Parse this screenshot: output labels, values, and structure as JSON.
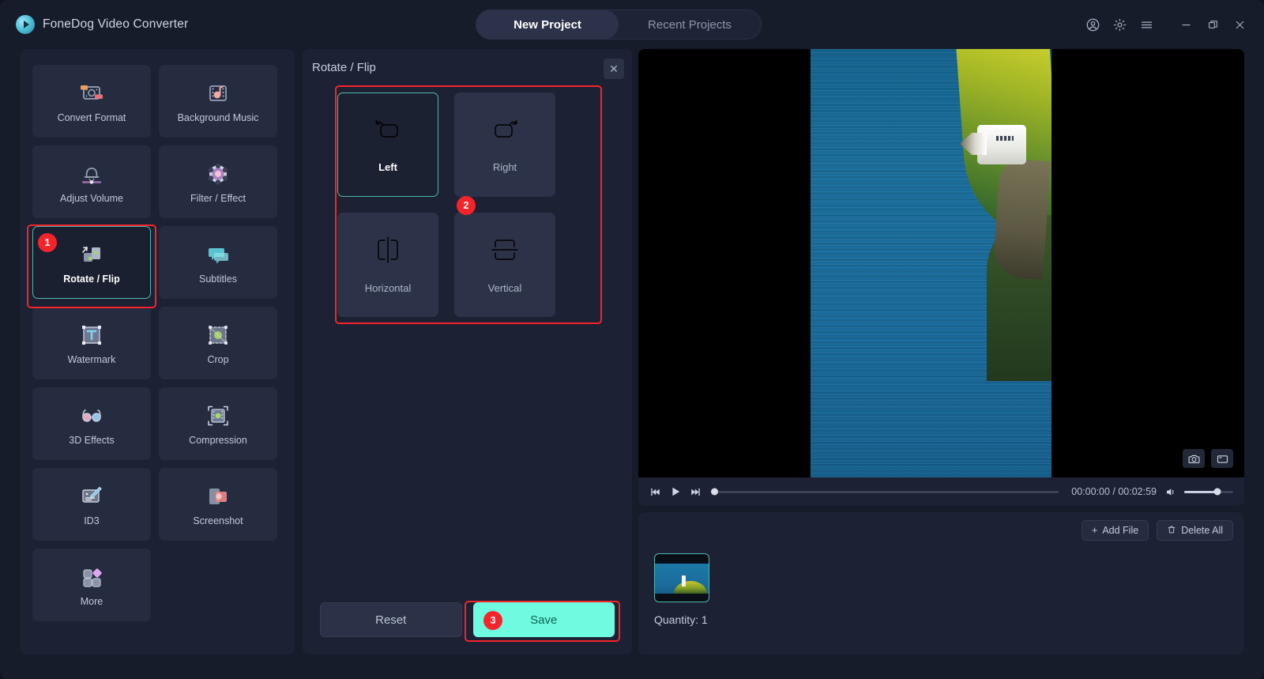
{
  "app": {
    "brand_name": "FoneDog Video Converter",
    "logo_icon": "play-circle-icon",
    "accent_teal": "#4fb8ac",
    "accent_save": "#6ffbe0",
    "annotation_red": "#f5242b",
    "bg_app": "#171c2b",
    "bg_panel": "#1c2133",
    "bg_tile": "#262c40"
  },
  "header": {
    "tabs": [
      {
        "label": "New Project",
        "active": true
      },
      {
        "label": "Recent Projects",
        "active": false
      }
    ],
    "window_icons": [
      {
        "name": "account-icon",
        "glyph": "account"
      },
      {
        "name": "settings-gear-icon",
        "glyph": "gear"
      },
      {
        "name": "hamburger-menu-icon",
        "glyph": "menu"
      },
      {
        "name": "minimize-icon",
        "glyph": "minimize"
      },
      {
        "name": "maximize-icon",
        "glyph": "maximize"
      },
      {
        "name": "close-icon",
        "glyph": "close"
      }
    ]
  },
  "sidebar": {
    "tools": [
      {
        "label": "Convert Format",
        "icon": "convert-format-icon",
        "selected": false
      },
      {
        "label": "Background Music",
        "icon": "background-music-icon",
        "selected": false
      },
      {
        "label": "Adjust Volume",
        "icon": "adjust-volume-icon",
        "selected": false
      },
      {
        "label": "Filter / Effect",
        "icon": "filter-effect-icon",
        "selected": false
      },
      {
        "label": "Rotate / Flip",
        "icon": "rotate-flip-icon",
        "selected": true
      },
      {
        "label": "Subtitles",
        "icon": "subtitles-icon",
        "selected": false
      },
      {
        "label": "Watermark",
        "icon": "watermark-icon",
        "selected": false
      },
      {
        "label": "Crop",
        "icon": "crop-icon",
        "selected": false
      },
      {
        "label": "3D Effects",
        "icon": "3d-effects-icon",
        "selected": false
      },
      {
        "label": "Compression",
        "icon": "compression-icon",
        "selected": false
      },
      {
        "label": "ID3",
        "icon": "id3-icon",
        "selected": false
      },
      {
        "label": "Screenshot",
        "icon": "screenshot-icon",
        "selected": false
      },
      {
        "label": "More",
        "icon": "more-icon",
        "selected": false
      }
    ]
  },
  "panel": {
    "title": "Rotate / Flip",
    "close_label": "✕",
    "options": [
      {
        "label": "Left",
        "icon": "rotate-left-icon",
        "selected": true
      },
      {
        "label": "Right",
        "icon": "rotate-right-icon",
        "selected": false
      },
      {
        "label": "Horizontal",
        "icon": "flip-horizontal-icon",
        "selected": false
      },
      {
        "label": "Vertical",
        "icon": "flip-vertical-icon",
        "selected": false
      }
    ],
    "reset_label": "Reset",
    "save_label": "Save"
  },
  "annotations": {
    "badge_1": "1",
    "badge_2": "2",
    "badge_3": "3"
  },
  "player": {
    "prev_icon": "skip-previous-icon",
    "play_icon": "play-icon",
    "next_icon": "skip-next-icon",
    "current_time": "00:00:00",
    "total_time": "00:02:59",
    "timecode": "00:00:00 / 00:02:59",
    "volume_icon": "volume-icon",
    "volume_percent": 68,
    "seek_percent": 0,
    "snapshot_icon": "camera-icon",
    "fullscreen_icon": "fullscreen-icon"
  },
  "filelist": {
    "add_file_label": "Add File",
    "add_file_icon": "plus-icon",
    "delete_all_label": "Delete All",
    "delete_all_icon": "trash-icon",
    "quantity_label": "Quantity: 1",
    "thumbnail_name": "lighthouse-thumbnail"
  }
}
